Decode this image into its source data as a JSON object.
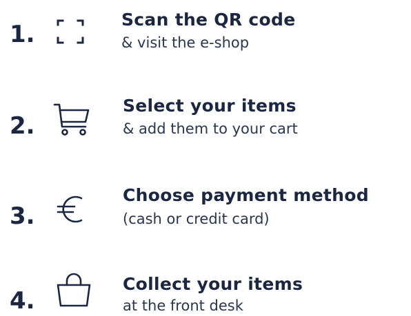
{
  "steps": [
    {
      "number": "1.",
      "icon": "qr-scan-icon",
      "title": "Scan the QR code",
      "subtitle": "& visit the e-shop"
    },
    {
      "number": "2.",
      "icon": "shopping-cart-icon",
      "title": "Select your items",
      "subtitle": "& add them to your cart"
    },
    {
      "number": "3.",
      "icon": "euro-icon",
      "title": "Choose payment method",
      "subtitle": "(cash or credit card)"
    },
    {
      "number": "4.",
      "icon": "shopping-bag-icon",
      "title": "Collect your items",
      "subtitle": "at the front desk"
    }
  ],
  "colors": {
    "text": "#1b2742",
    "background": "#ffffff"
  }
}
